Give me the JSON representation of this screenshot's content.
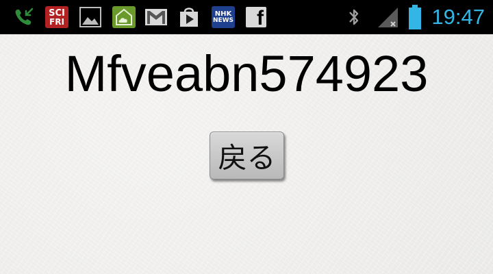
{
  "status_bar": {
    "notification_icons": [
      "missed-call-icon",
      "sci-fri-icon",
      "gallery-icon",
      "weather-icon",
      "gmail-icon",
      "play-store-icon",
      "nhk-news-icon",
      "facebook-icon"
    ],
    "scifri_line1": "SCI",
    "scifri_line2": "FRI",
    "nhk_line1": "NHK",
    "nhk_line2": "NEWS",
    "facebook_glyph": "f",
    "clock": "19:47",
    "colors": {
      "clock": "#33b5e5",
      "battery": "#33b5e5",
      "bar_background": "#000000"
    }
  },
  "main": {
    "title": "Mfveabn574923",
    "back_button_label": "戻る"
  }
}
